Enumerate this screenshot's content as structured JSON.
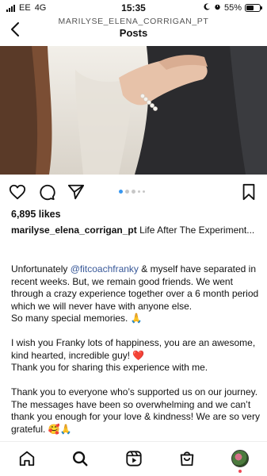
{
  "status_bar": {
    "carrier": "EE",
    "network": "4G",
    "time": "15:35",
    "battery": "55%",
    "battery_level": 0.55
  },
  "header": {
    "username": "MARILYSE_ELENA_CORRIGAN_PT",
    "title": "Posts"
  },
  "post": {
    "likes": "6,895 likes",
    "caption_user": "marilyse_elena_corrigan_pt",
    "caption_text": " Life After The Experiment...",
    "carousel": {
      "count": 5,
      "active_index": 0
    },
    "p1_before": "Unfortunately ",
    "p1_mention": "@fitcoachfranky",
    "p1_after": " & myself have separated in recent weeks. But, we remain good friends. We went through a crazy experience together over a 6 month period which we will never have with anyone else.",
    "p1_line2": "So many special memories. 🙏",
    "p2_line1": "I wish you Franky lots of happiness, you are an awesome, kind hearted, incredible guy! ❤️",
    "p2_line2": "Thank you for sharing this experience with me.",
    "p3_line1": "Thank you to everyone who’s supported us on our journey. The messages have been so overwhelming and we can’t thank you enough for your love & kindness! We are so very grateful. 🥰🙏"
  },
  "icons": {
    "back": "chevron-left-icon",
    "like": "heart-icon",
    "comment": "comment-icon",
    "share": "send-icon",
    "save": "bookmark-icon",
    "nav": [
      "home-icon",
      "search-icon",
      "reels-icon",
      "shop-icon",
      "profile-avatar"
    ]
  },
  "colors": {
    "mention": "#385898",
    "carousel_active": "#3897f0",
    "notification": "#ed4956"
  }
}
